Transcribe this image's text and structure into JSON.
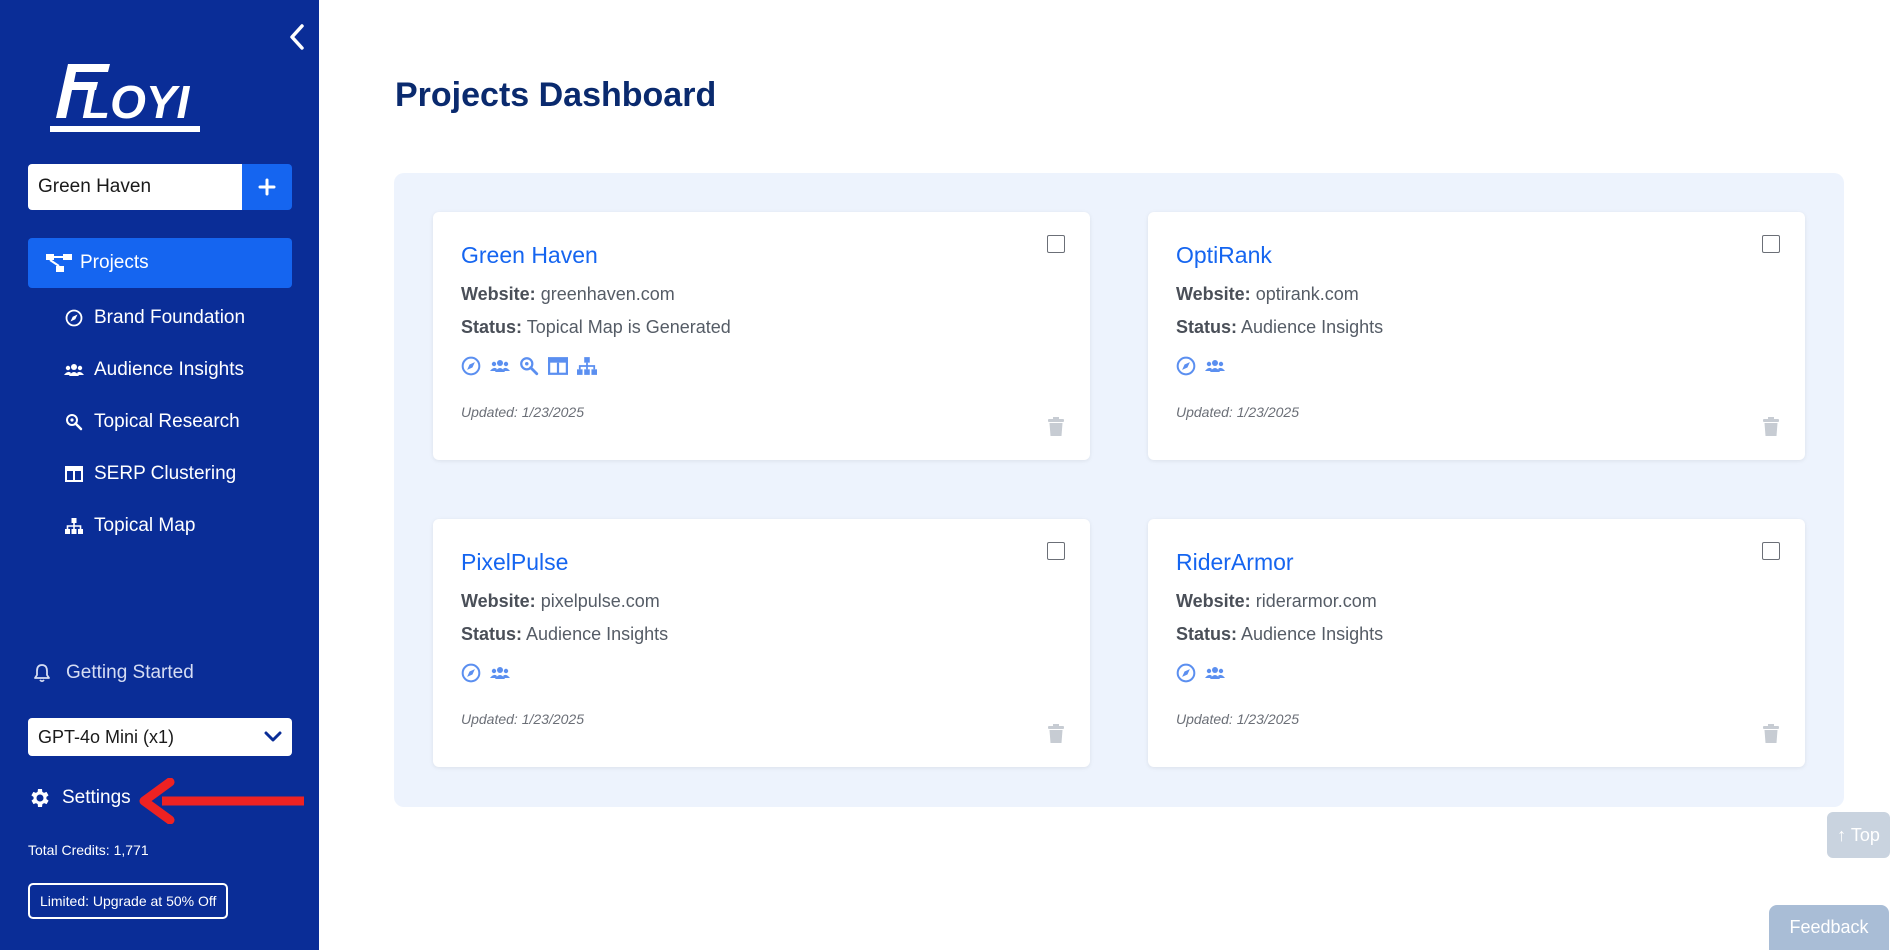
{
  "app": {
    "logo_text": "FLOYI"
  },
  "sidebar": {
    "project_selector": {
      "value": "Green Haven"
    },
    "nav": {
      "projects": "Projects",
      "brand_foundation": "Brand Foundation",
      "audience_insights": "Audience Insights",
      "topical_research": "Topical Research",
      "serp_clustering": "SERP Clustering",
      "topical_map": "Topical Map"
    },
    "getting_started": "Getting Started",
    "model_select": {
      "value": "GPT-4o Mini (x1)"
    },
    "settings": "Settings",
    "credits": "Total Credits: 1,771",
    "upgrade": "Limited: Upgrade at 50% Off"
  },
  "main": {
    "title": "Projects Dashboard",
    "website_label": "Website:",
    "status_label": "Status:",
    "cards": [
      {
        "name": "Green Haven",
        "website": "greenhaven.com",
        "status": "Topical Map is Generated",
        "updated": "Updated: 1/23/2025",
        "icons": [
          "compass-icon",
          "users-icon",
          "search-icon",
          "columns-icon",
          "sitemap-icon"
        ]
      },
      {
        "name": "OptiRank",
        "website": "optirank.com",
        "status": "Audience Insights",
        "updated": "Updated: 1/23/2025",
        "icons": [
          "compass-icon",
          "users-icon"
        ]
      },
      {
        "name": "PixelPulse",
        "website": "pixelpulse.com",
        "status": "Audience Insights",
        "updated": "Updated: 1/23/2025",
        "icons": [
          "compass-icon",
          "users-icon"
        ]
      },
      {
        "name": "RiderArmor",
        "website": "riderarmor.com",
        "status": "Audience Insights",
        "updated": "Updated: 1/23/2025",
        "icons": [
          "compass-icon",
          "users-icon"
        ]
      }
    ]
  },
  "floating": {
    "top": "↑ Top",
    "feedback": "Feedback"
  },
  "colors": {
    "sidebar": "#0a2d97",
    "accent": "#1565f0",
    "board": "#edf3fd",
    "icon": "#5b8ff0",
    "annotation": "#ee2222"
  }
}
